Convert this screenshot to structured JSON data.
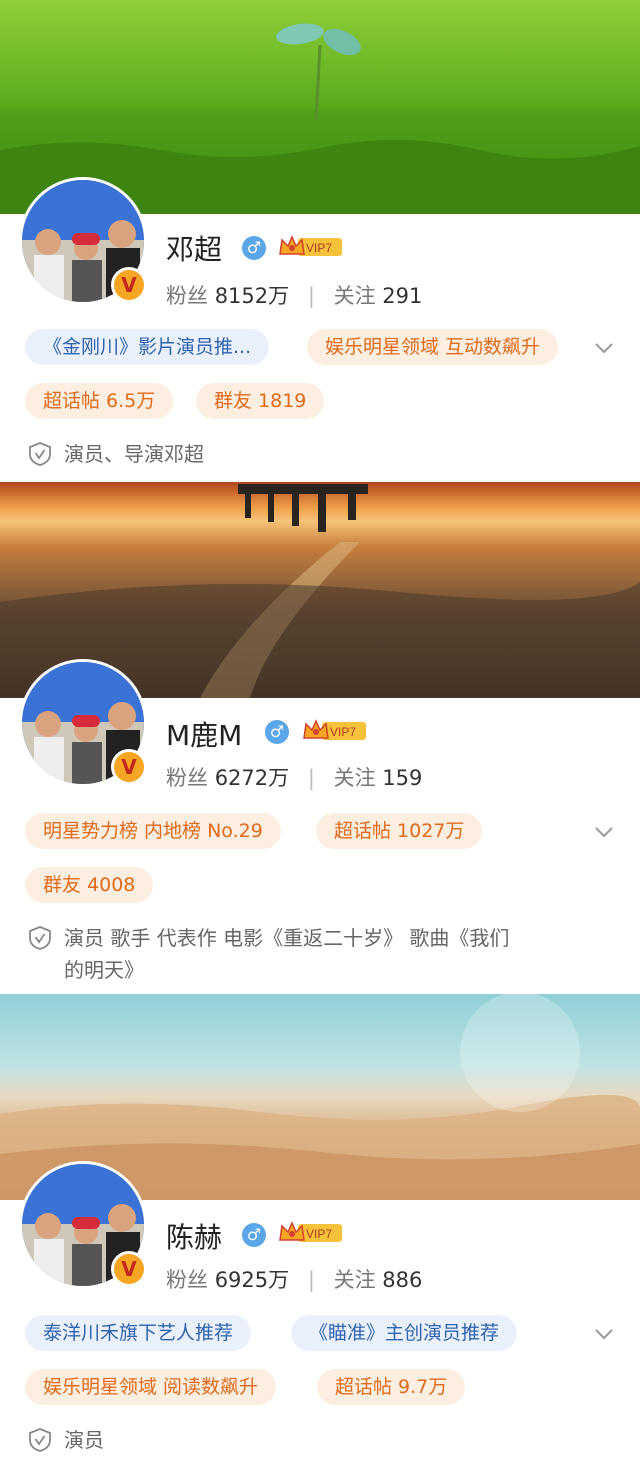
{
  "profiles": [
    {
      "name": "邓超",
      "vip": "VIP7",
      "fans_label": "粉丝",
      "fans": "8152万",
      "follow_label": "关注",
      "follow": "291",
      "tags": [
        "《金刚川》影片演员推...",
        "娱乐明星领域 互动数飙升",
        "超话帖 6.5万",
        "群友 1819"
      ],
      "bio": "演员、导演邓超"
    },
    {
      "name": "M鹿M",
      "vip": "VIP7",
      "fans_label": "粉丝",
      "fans": "6272万",
      "follow_label": "关注",
      "follow": "159",
      "tags": [
        "明星势力榜 内地榜 No.29",
        "超话帖 1027万",
        "群友 4008"
      ],
      "bio_line1": "演员 歌手 代表作 电影《重返二十岁》 歌曲《我们",
      "bio_line2": "的明天》"
    },
    {
      "name": "陈赫",
      "vip": "VIP7",
      "fans_label": "粉丝",
      "fans": "6925万",
      "follow_label": "关注",
      "follow": "886",
      "tags": [
        "泰洋川禾旗下艺人推荐",
        "《瞄准》主创演员推荐",
        "娱乐明星领域 阅读数飙升",
        "超话帖 9.7万"
      ],
      "bio": "演员"
    }
  ],
  "colors": {
    "tag_blue_bg": "#eaf1fc",
    "tag_blue_text": "#2f62b0",
    "tag_orange_bg": "#fdeee2",
    "tag_orange_text": "#e06a1b",
    "vip_gold": "#f6c23c",
    "gender_blue": "#5aa6e8"
  }
}
